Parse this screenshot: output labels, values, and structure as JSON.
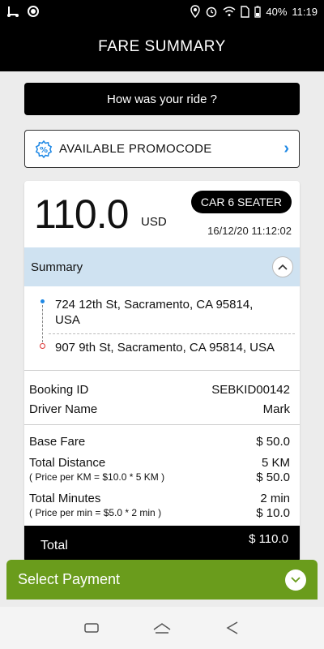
{
  "status_bar": {
    "battery": "40%",
    "time": "11:19"
  },
  "header": {
    "title": "FARE SUMMARY"
  },
  "rate_ride": {
    "label": "How was your ride ?"
  },
  "promo": {
    "label": "AVAILABLE PROMOCODE",
    "accent": "#1e88e5"
  },
  "fare": {
    "amount": "110.0",
    "currency": "USD",
    "car_type": "CAR 6 SEATER",
    "datetime": "16/12/20 11:12:02"
  },
  "summary": {
    "label": "Summary"
  },
  "route": {
    "pickup": "724 12th St, Sacramento, CA 95814, USA",
    "drop": "907 9th St, Sacramento, CA 95814, USA"
  },
  "booking": {
    "id_label": "Booking ID",
    "id_value": "SEBKID00142",
    "driver_label": "Driver Name",
    "driver_value": "Mark"
  },
  "charges": {
    "base_label": "Base Fare",
    "base_value": "$ 50.0",
    "distance_label": "Total Distance",
    "distance_value": "5 KM",
    "distance_formula": "( Price per KM = $10.0 * 5 KM )",
    "distance_amount": "$ 50.0",
    "minutes_label": "Total Minutes",
    "minutes_value": "2 min",
    "minutes_formula": "( Price per min = $5.0 * 2 min )",
    "minutes_amount": "$ 10.0"
  },
  "total": {
    "label": "Total",
    "value": "$ 110.0"
  },
  "payment": {
    "label": "Select Payment",
    "color": "#6a9c1c"
  }
}
